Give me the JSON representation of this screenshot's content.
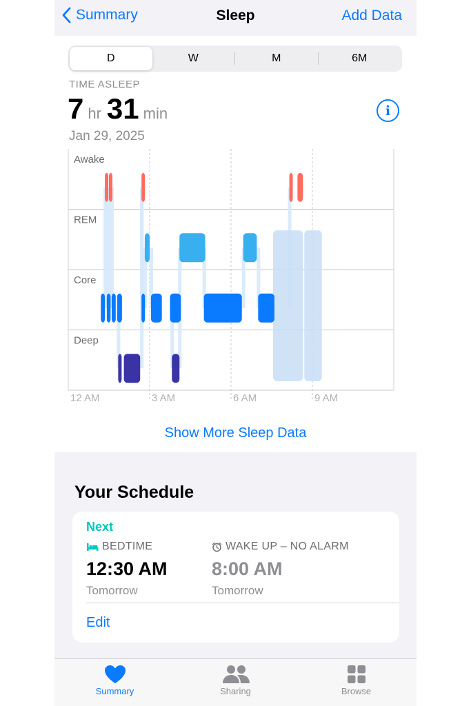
{
  "nav": {
    "back_label": "Summary",
    "title": "Sleep",
    "action_label": "Add Data"
  },
  "segments": {
    "items": [
      "D",
      "W",
      "M",
      "6M"
    ],
    "selected": "D"
  },
  "time_asleep": {
    "label": "TIME ASLEEP",
    "hours": "7",
    "hours_unit": "hr",
    "minutes": "31",
    "minutes_unit": "min",
    "date": "Jan 29, 2025"
  },
  "chart_data": {
    "type": "sleep-stages",
    "stages": [
      "Awake",
      "REM",
      "Core",
      "Deep"
    ],
    "x_ticks": [
      "12 AM",
      "3 AM",
      "6 AM",
      "9 AM"
    ],
    "x_range_hours": [
      0,
      12
    ],
    "colors": {
      "Awake": "#ff6b5e",
      "REM": "#38b0f0",
      "Core": "#0a7aff",
      "Deep": "#3a33a6"
    },
    "segments": [
      {
        "stage": "Awake",
        "start": 1.35,
        "end": 1.42
      },
      {
        "stage": "Awake",
        "start": 1.5,
        "end": 1.56
      },
      {
        "stage": "Core",
        "start": 1.2,
        "end": 1.35
      },
      {
        "stage": "Core",
        "start": 1.42,
        "end": 1.56
      },
      {
        "stage": "Core",
        "start": 1.6,
        "end": 1.75
      },
      {
        "stage": "Core",
        "start": 1.8,
        "end": 1.98
      },
      {
        "stage": "Deep",
        "start": 1.84,
        "end": 1.93
      },
      {
        "stage": "Deep",
        "start": 2.05,
        "end": 2.65
      },
      {
        "stage": "Awake",
        "start": 2.7,
        "end": 2.77
      },
      {
        "stage": "Core",
        "start": 2.7,
        "end": 2.78
      },
      {
        "stage": "REM",
        "start": 2.82,
        "end": 3.0
      },
      {
        "stage": "Core",
        "start": 3.05,
        "end": 3.45
      },
      {
        "stage": "Core",
        "start": 3.75,
        "end": 4.15
      },
      {
        "stage": "Deep",
        "start": 3.82,
        "end": 4.1
      },
      {
        "stage": "REM",
        "start": 4.1,
        "end": 5.05
      },
      {
        "stage": "Core",
        "start": 5.0,
        "end": 6.4
      },
      {
        "stage": "REM",
        "start": 6.45,
        "end": 6.95
      },
      {
        "stage": "Core",
        "start": 7.0,
        "end": 7.6
      },
      {
        "stage": "Awake",
        "start": 8.15,
        "end": 8.22
      },
      {
        "stage": "Awake",
        "start": 8.45,
        "end": 8.65
      }
    ]
  },
  "show_more": "Show More Sleep Data",
  "schedule": {
    "title": "Your Schedule",
    "next_label": "Next",
    "bedtime": {
      "label": "BEDTIME",
      "time": "12:30 AM",
      "day": "Tomorrow"
    },
    "wake": {
      "label": "WAKE UP – NO ALARM",
      "time": "8:00 AM",
      "day": "Tomorrow"
    },
    "edit_label": "Edit"
  },
  "tabs": [
    {
      "label": "Summary",
      "icon": "heart-icon",
      "active": true
    },
    {
      "label": "Sharing",
      "icon": "people-icon",
      "active": false
    },
    {
      "label": "Browse",
      "icon": "grid-icon",
      "active": false
    }
  ]
}
